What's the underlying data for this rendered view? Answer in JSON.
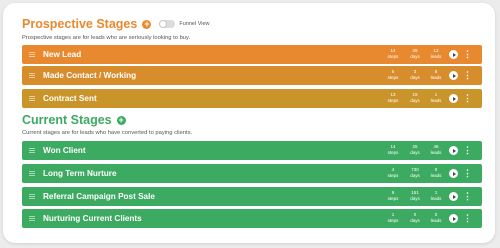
{
  "prospective": {
    "title": "Prospective Stages",
    "add_icon": "+",
    "toggle_label": "Funnel View",
    "description": "Prospective stages are for leads who are seriously looking to buy.",
    "color": "#e8892f",
    "stages": [
      {
        "name": "New Lead",
        "steps": "14",
        "days": "29",
        "leads": "13",
        "steps_label": "steps",
        "days_label": "days",
        "leads_label": "leads",
        "color": "#e8892f"
      },
      {
        "name": "Made Contact / Working",
        "steps": "6",
        "days": "3",
        "leads": "8",
        "steps_label": "steps",
        "days_label": "days",
        "leads_label": "leads",
        "color": "#d88d2c"
      },
      {
        "name": "Contract Sent",
        "steps": "13",
        "days": "19",
        "leads": "1",
        "steps_label": "steps",
        "days_label": "days",
        "leads_label": "leads",
        "color": "#c99429"
      }
    ]
  },
  "current": {
    "title": "Current Stages",
    "add_icon": "+",
    "description": "Current stages are for leads who have converted to paying clients.",
    "color": "#3daa62",
    "stages": [
      {
        "name": "Won Client",
        "steps": "14",
        "days": "25",
        "leads": "48",
        "steps_label": "steps",
        "days_label": "days",
        "leads_label": "leads",
        "color": "#3daa62"
      },
      {
        "name": "Long Term Nurture",
        "steps": "4",
        "days": "730",
        "leads": "8",
        "steps_label": "steps",
        "days_label": "days",
        "leads_label": "leads",
        "color": "#3daa62"
      },
      {
        "name": "Referral Campaign Post Sale",
        "steps": "9",
        "days": "151",
        "leads": "1",
        "steps_label": "steps",
        "days_label": "days",
        "leads_label": "leads",
        "color": "#3daa62"
      },
      {
        "name": "Nurturing Current Clients",
        "steps": "1",
        "days": "0",
        "leads": "0",
        "steps_label": "steps",
        "days_label": "days",
        "leads_label": "leads",
        "color": "#3daa62"
      }
    ]
  },
  "icons": {
    "drag": "drag-handle-icon",
    "play": "play-circle-icon",
    "more": "more-vertical-icon",
    "more_glyph": "⋮"
  }
}
